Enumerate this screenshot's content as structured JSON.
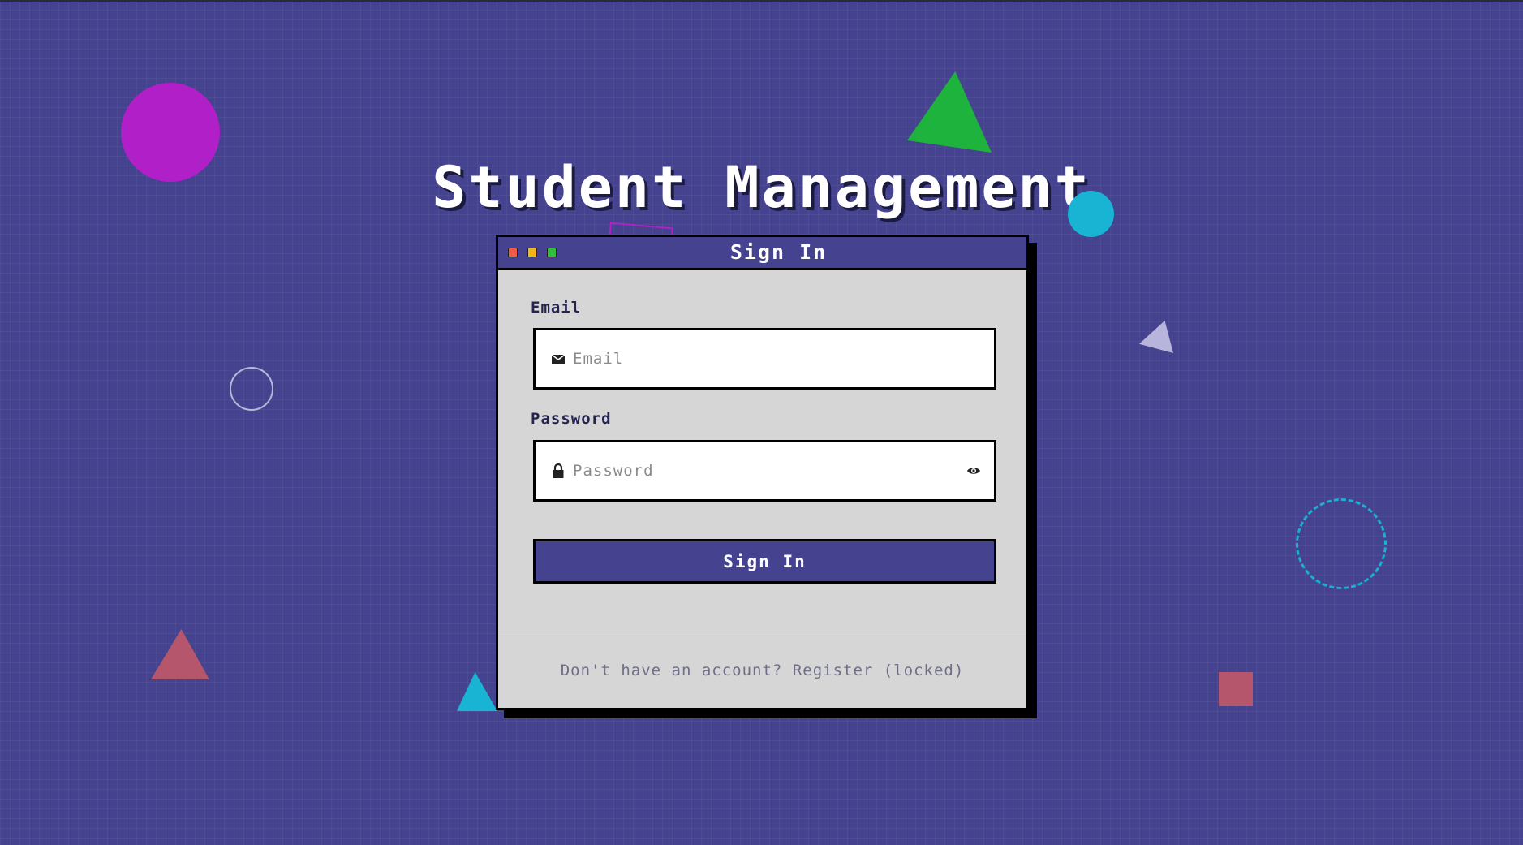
{
  "page": {
    "title": "Student Management"
  },
  "window": {
    "title": "Sign In",
    "controls": [
      "close",
      "minimize",
      "maximize"
    ]
  },
  "form": {
    "email": {
      "label": "Email",
      "placeholder": "Email",
      "value": "",
      "icon": "envelope-icon"
    },
    "password": {
      "label": "Password",
      "placeholder": "Password",
      "value": "",
      "icon": "lock-icon",
      "toggle_icon": "eye-icon"
    },
    "submit_label": "Sign In"
  },
  "footer": {
    "prompt": "Don't have an account?",
    "register_label": "Register (locked)"
  },
  "colors": {
    "background": "#45438f",
    "card": "#d6d6d6",
    "accent": "#45438f",
    "control_close": "#f05a4a",
    "control_minimize": "#f3b51a",
    "control_maximize": "#2fbf3f"
  }
}
